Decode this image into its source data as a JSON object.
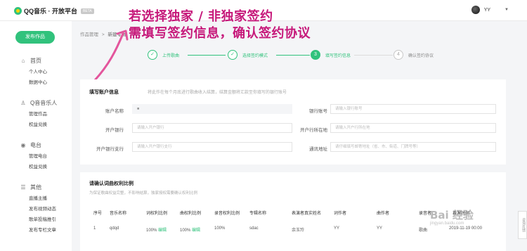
{
  "header": {
    "logo_text": "QQ音乐 · 开放平台",
    "beta": "BETA",
    "user_name": "YY",
    "caret": "▼"
  },
  "sidebar": {
    "publish_label": "发布作品",
    "groups": [
      {
        "icon": "home-icon",
        "icon_glyph": "⌂",
        "label": "首页",
        "items": [
          "个人中心",
          "数据中心"
        ]
      },
      {
        "icon": "person-icon",
        "icon_glyph": "♙",
        "label": "Q音音乐人",
        "items": [
          "管理作品",
          "权益兑换"
        ]
      },
      {
        "icon": "radio-icon",
        "icon_glyph": "◉",
        "label": "电台",
        "items": [
          "管理电台",
          "权益兑换"
        ]
      },
      {
        "icon": "menu-icon",
        "icon_glyph": "☰",
        "label": "其他",
        "items": [
          "直播主播",
          "发布视频动态",
          "歌单投稿推引",
          "发布专栏文章"
        ]
      }
    ]
  },
  "breadcrumb": {
    "parent": "作品管理",
    "sep": ">",
    "current": "新建专辑"
  },
  "steps": [
    {
      "num": "✓",
      "label": "上传歌曲",
      "state": "done"
    },
    {
      "num": "✓",
      "label": "选择签约模式",
      "state": "done"
    },
    {
      "num": "3",
      "label": "填写签约信息",
      "state": "active"
    },
    {
      "num": "4",
      "label": "确认签约协议",
      "state": "todo"
    }
  ],
  "annotation": {
    "line1": "若选择独家 / 非独家签约",
    "line2": "需填写签约信息，确认签约协议"
  },
  "account": {
    "title": "填写账户信息",
    "tip": "将此作在每个月底进行歌曲收入结算，结算金额将汇款至你填写的银行账号",
    "fields": [
      {
        "label": "账户名称",
        "value": "■",
        "placeholder": ""
      },
      {
        "label": "银行账号",
        "value": "",
        "placeholder": "请输入银行账号"
      },
      {
        "label": "开户银行",
        "value": "",
        "placeholder": "请输入开户银行"
      },
      {
        "label": "开户行所在地",
        "value": "",
        "placeholder": "请输入开户行所在地"
      },
      {
        "label": "开户银行支行",
        "value": "",
        "placeholder": "请输入开户银行支行"
      },
      {
        "label": "通讯地址",
        "value": "",
        "placeholder": "请仔细填写邮寄地址（省、市、街道、门牌号等）"
      }
    ]
  },
  "rights": {
    "title": "请确认词曲权利比例",
    "subtitle": "为保证歌曲权益完整，不影响结算，独家授权需要确认权利比例",
    "columns": [
      "序号",
      "音乐名称",
      "词权利比例",
      "曲权利比例",
      "录音权利比例",
      "专辑名称",
      "表演者真实姓名",
      "词作者",
      "曲作者",
      "录音者",
      "首发时间"
    ],
    "rows": [
      {
        "index": "1",
        "name": "qdqd",
        "lyric_ratio": "100%",
        "lyric_edit": "编辑",
        "music_ratio": "100%",
        "music_edit": "编辑",
        "record_ratio": "100%",
        "album": "sdac",
        "performer": "余玉玲",
        "lyricist": "YY",
        "composer": "YY",
        "recorder": "歌曲",
        "release": "2019-11-19 00:00"
      }
    ]
  },
  "watermark": {
    "brand": "Bai 经验",
    "site": "jingyan.baidu.com"
  },
  "side_tab": "咨询反馈"
}
